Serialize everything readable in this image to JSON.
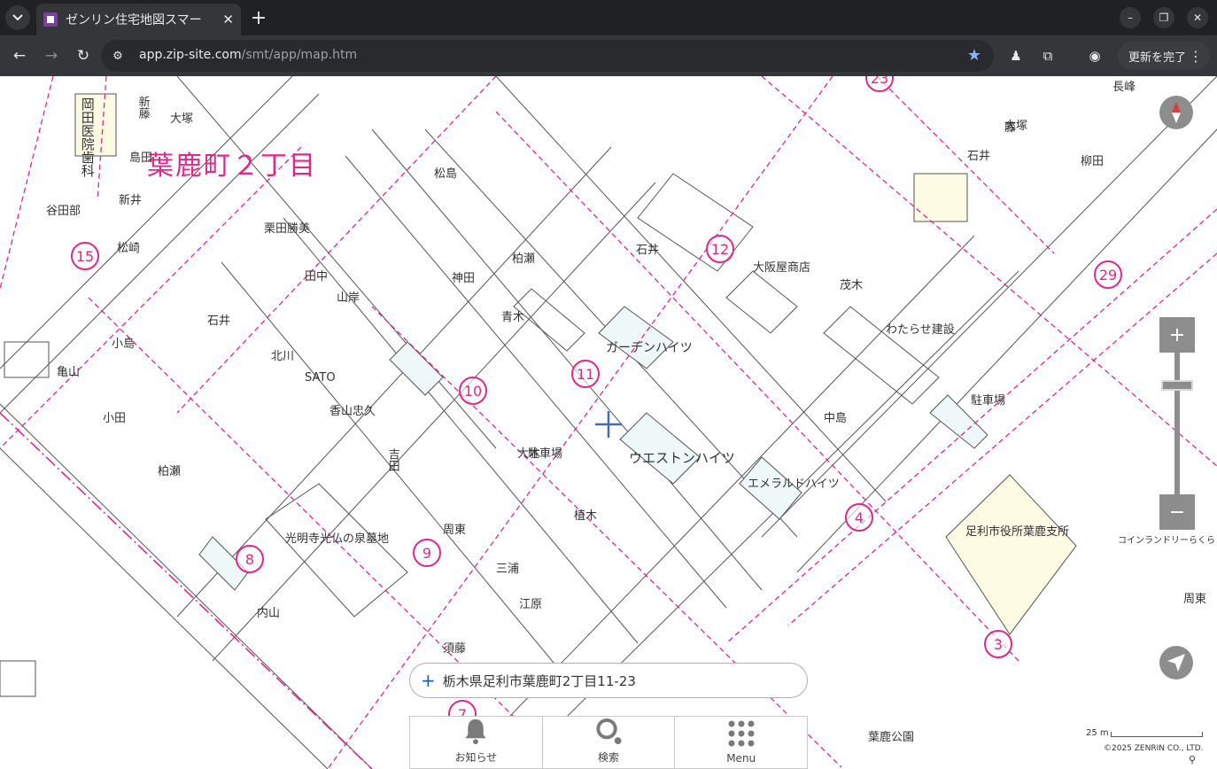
{
  "browser": {
    "tab_title": "ゼンリン住宅地図スマー",
    "url_host": "app.zip-site.com",
    "url_path": "/smt/app/map.htm",
    "update_button": "更新を完了"
  },
  "map": {
    "town_label": "葉鹿町２丁目",
    "block_numbers": [
      "15",
      "10",
      "11",
      "12",
      "8",
      "9",
      "4",
      "3",
      "29",
      "23",
      "7"
    ],
    "labels": [
      "岡田医院歯科",
      "新藤",
      "大塚",
      "島田",
      "新井",
      "谷田部",
      "松崎",
      "小島",
      "亀山",
      "小田",
      "石井",
      "柏瀬",
      "北川",
      "SATO",
      "香山忠久",
      "吉田",
      "栗田勝美",
      "山岸",
      "田中",
      "柏瀬",
      "石井",
      "青木",
      "松島",
      "神田",
      "大阪屋商店",
      "茂木",
      "わたらせ建設",
      "駐車場",
      "植木",
      "江原",
      "周東",
      "内山",
      "柳田",
      "大塚",
      "石井",
      "藤",
      "長峰",
      "中島",
      "三浦",
      "須藤",
      "大木",
      "駐車場",
      "葉鹿公園",
      "光明寺光仏の泉墓地",
      "足利市役所葉鹿支所",
      "ウエストンハイツ",
      "ガーデンハイツ",
      "エメラルドハイツ",
      "コインランドリーらくらく",
      "周東"
    ]
  },
  "address": "栃木県足利市葉鹿町2丁目11-23",
  "bottom_nav": {
    "notice": "お知らせ",
    "search": "検索",
    "menu": "Menu"
  },
  "scale_label": "25 m",
  "copyright": "©2025 ZENRIN CO., LTD."
}
